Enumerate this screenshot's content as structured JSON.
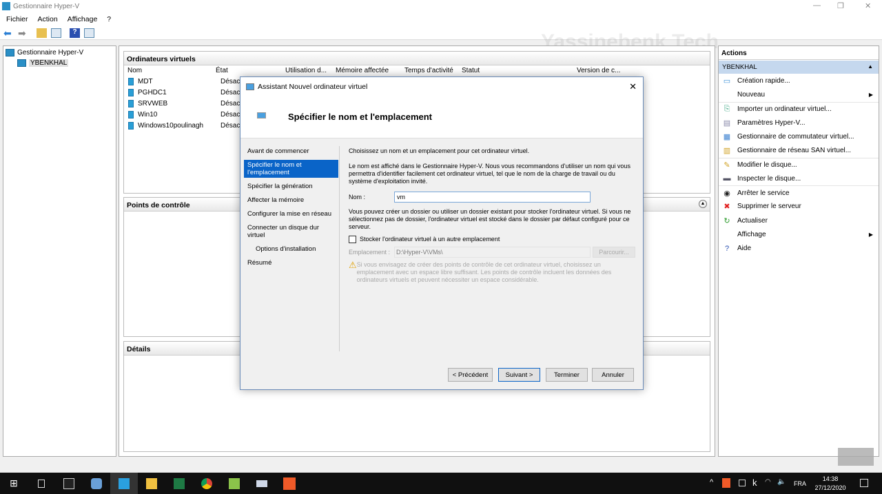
{
  "window": {
    "title": "Gestionnaire Hyper-V",
    "minimize": "—",
    "maximize": "❐",
    "close": "✕"
  },
  "menu": [
    "Fichier",
    "Action",
    "Affichage",
    "?"
  ],
  "watermark": "Yassinebenk Tech",
  "tree": {
    "root": "Gestionnaire Hyper-V",
    "server": "YBENKHAL"
  },
  "vms": {
    "title": "Ordinateurs virtuels",
    "columns": [
      "Nom",
      "État",
      "Utilisation d...",
      "Mémoire affectée",
      "Temps d'activité",
      "Statut",
      "Version de c..."
    ],
    "rows": [
      {
        "name": "MDT",
        "state": "Désactivé"
      },
      {
        "name": "PGHDC1",
        "state": "Désactivé"
      },
      {
        "name": "SRVWEB",
        "state": "Désactivé"
      },
      {
        "name": "Win10",
        "state": "Désactivé"
      },
      {
        "name": "Windows10poulinagh",
        "state": "Désactivé"
      }
    ]
  },
  "checkpoints": {
    "title": "Points de contrôle"
  },
  "details": {
    "title": "Détails"
  },
  "actions": {
    "title": "Actions",
    "section": "YBENKHAL",
    "items": [
      "Création rapide...",
      "Nouveau",
      "Importer un ordinateur virtuel...",
      "Paramètres Hyper-V...",
      "Gestionnaire de commutateur virtuel...",
      "Gestionnaire de réseau SAN virtuel...",
      "Modifier le disque...",
      "Inspecter le disque...",
      "Arrêter le service",
      "Supprimer le serveur",
      "Actualiser",
      "Affichage",
      "Aide"
    ]
  },
  "dialog": {
    "title": "Assistant Nouvel ordinateur virtuel",
    "heading": "Spécifier le nom et l'emplacement",
    "steps": [
      "Avant de commencer",
      "Spécifier le nom et l'emplacement",
      "Spécifier la génération",
      "Affecter la mémoire",
      "Configurer la mise en réseau",
      "Connecter un disque dur virtuel",
      "Options d'installation",
      "Résumé"
    ],
    "intro": "Choisissez un nom et un emplacement pour cet ordinateur virtuel.",
    "desc": "Le nom est affiché dans le Gestionnaire Hyper-V. Nous vous recommandons d'utiliser un nom qui vous permettra d'identifier facilement cet ordinateur virtuel, tel que le nom de la charge de travail ou du système d'exploitation invité.",
    "name_label": "Nom :",
    "name_value": "vm",
    "folder_desc": "Vous pouvez créer un dossier ou utiliser un dossier existant pour stocker l'ordinateur virtuel. Si vous ne sélectionnez pas de dossier, l'ordinateur virtuel est stocké dans le dossier par défaut configuré pour ce serveur.",
    "checkbox_label": "Stocker l'ordinateur virtuel à un autre emplacement",
    "location_label": "Emplacement :",
    "location_value": "D:\\Hyper-V\\VMs\\",
    "browse": "Parcourir...",
    "warning": "Si vous envisagez de créer des points de contrôle de cet ordinateur virtuel, choisissez un emplacement avec un espace libre suffisant. Les points de contrôle incluent les données des ordinateurs virtuels et peuvent nécessiter un espace considérable.",
    "buttons": {
      "prev": "< Précédent",
      "next": "Suivant >",
      "finish": "Terminer",
      "cancel": "Annuler"
    }
  },
  "tray": {
    "lang": "FRA",
    "time": "14:38",
    "date": "27/12/2020"
  }
}
